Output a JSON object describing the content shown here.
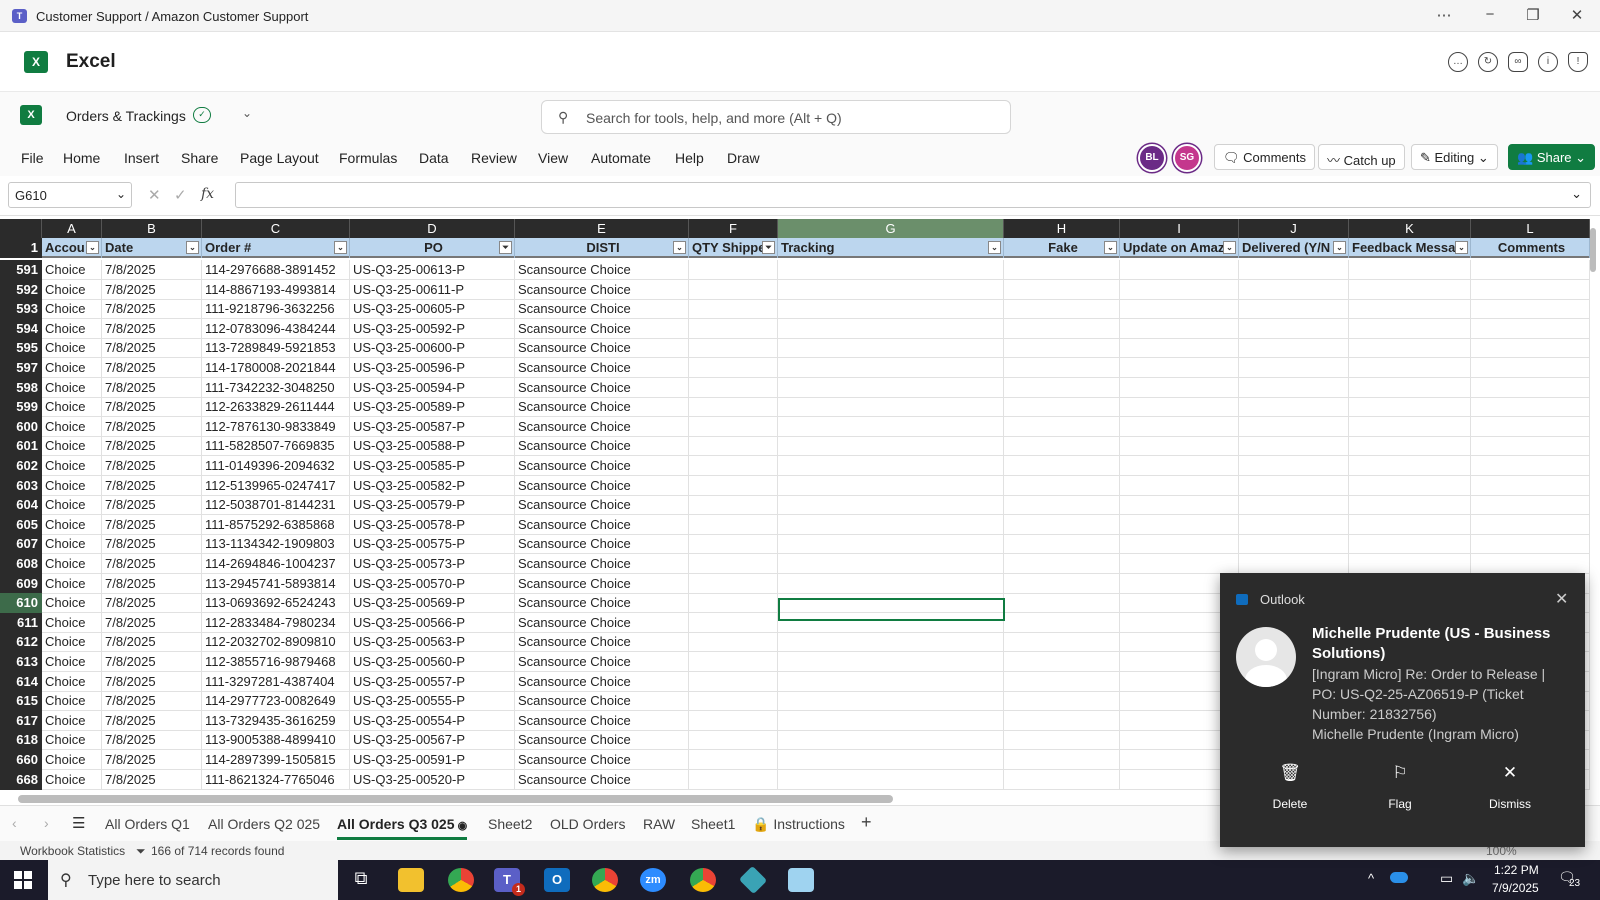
{
  "window": {
    "title": "Customer Support / Amazon Customer Support"
  },
  "app": {
    "name": "Excel",
    "file_name": "Orders & Trackings"
  },
  "search": {
    "placeholder": "Search for tools, help, and more (Alt + Q)"
  },
  "ribbon": {
    "tabs": [
      "File",
      "Home",
      "Insert",
      "Share",
      "Page Layout",
      "Formulas",
      "Data",
      "Review",
      "View",
      "Automate",
      "Help",
      "Draw"
    ],
    "avatars": [
      "BL",
      "SG"
    ],
    "comments_label": "Comments",
    "catchup_label": "Catch up",
    "editing_label": "Editing",
    "share_label": "Share"
  },
  "formula_bar": {
    "name_box": "G610",
    "formula": ""
  },
  "grid": {
    "column_letters": [
      "A",
      "B",
      "C",
      "D",
      "E",
      "F",
      "G",
      "H",
      "I",
      "J",
      "K",
      "L"
    ],
    "header_row_number": "1",
    "headers": [
      "Accou",
      "Date",
      "Order #",
      "PO",
      "DISTI",
      "QTY Shippe",
      "Tracking",
      "Fake",
      "Update on Amaz",
      "Delivered (Y/N",
      "Feedback Messa",
      "Comments"
    ],
    "filtered_columns": [
      "D",
      "F"
    ],
    "selected_column": "G",
    "selected_cell": "G610",
    "rows": [
      {
        "n": "591",
        "a": "Choice",
        "b": "7/8/2025",
        "c": "114-2976688-3891452",
        "d": "US-Q3-25-00613-P",
        "e": "Scansource Choice"
      },
      {
        "n": "592",
        "a": "Choice",
        "b": "7/8/2025",
        "c": "114-8867193-4993814",
        "d": "US-Q3-25-00611-P",
        "e": "Scansource Choice"
      },
      {
        "n": "593",
        "a": "Choice",
        "b": "7/8/2025",
        "c": "111-9218796-3632256",
        "d": "US-Q3-25-00605-P",
        "e": "Scansource Choice"
      },
      {
        "n": "594",
        "a": "Choice",
        "b": "7/8/2025",
        "c": "112-0783096-4384244",
        "d": "US-Q3-25-00592-P",
        "e": "Scansource Choice"
      },
      {
        "n": "595",
        "a": "Choice",
        "b": "7/8/2025",
        "c": "113-7289849-5921853",
        "d": "US-Q3-25-00600-P",
        "e": "Scansource Choice"
      },
      {
        "n": "597",
        "a": "Choice",
        "b": "7/8/2025",
        "c": "114-1780008-2021844",
        "d": "US-Q3-25-00596-P",
        "e": "Scansource Choice"
      },
      {
        "n": "598",
        "a": "Choice",
        "b": "7/8/2025",
        "c": "111-7342232-3048250",
        "d": "US-Q3-25-00594-P",
        "e": "Scansource Choice"
      },
      {
        "n": "599",
        "a": "Choice",
        "b": "7/8/2025",
        "c": "112-2633829-2611444",
        "d": "US-Q3-25-00589-P",
        "e": "Scansource Choice"
      },
      {
        "n": "600",
        "a": "Choice",
        "b": "7/8/2025",
        "c": "112-7876130-9833849",
        "d": "US-Q3-25-00587-P",
        "e": "Scansource Choice"
      },
      {
        "n": "601",
        "a": "Choice",
        "b": "7/8/2025",
        "c": "111-5828507-7669835",
        "d": "US-Q3-25-00588-P",
        "e": "Scansource Choice"
      },
      {
        "n": "602",
        "a": "Choice",
        "b": "7/8/2025",
        "c": "111-0149396-2094632",
        "d": "US-Q3-25-00585-P",
        "e": "Scansource Choice"
      },
      {
        "n": "603",
        "a": "Choice",
        "b": "7/8/2025",
        "c": "112-5139965-0247417",
        "d": "US-Q3-25-00582-P",
        "e": "Scansource Choice"
      },
      {
        "n": "604",
        "a": "Choice",
        "b": "7/8/2025",
        "c": "112-5038701-8144231",
        "d": "US-Q3-25-00579-P",
        "e": "Scansource Choice"
      },
      {
        "n": "605",
        "a": "Choice",
        "b": "7/8/2025",
        "c": "111-8575292-6385868",
        "d": "US-Q3-25-00578-P",
        "e": "Scansource Choice"
      },
      {
        "n": "607",
        "a": "Choice",
        "b": "7/8/2025",
        "c": "113-1134342-1909803",
        "d": "US-Q3-25-00575-P",
        "e": "Scansource Choice"
      },
      {
        "n": "608",
        "a": "Choice",
        "b": "7/8/2025",
        "c": "114-2694846-1004237",
        "d": "US-Q3-25-00573-P",
        "e": "Scansource Choice"
      },
      {
        "n": "609",
        "a": "Choice",
        "b": "7/8/2025",
        "c": "113-2945741-5893814",
        "d": "US-Q3-25-00570-P",
        "e": "Scansource Choice"
      },
      {
        "n": "610",
        "a": "Choice",
        "b": "7/8/2025",
        "c": "113-0693692-6524243",
        "d": "US-Q3-25-00569-P",
        "e": "Scansource Choice"
      },
      {
        "n": "611",
        "a": "Choice",
        "b": "7/8/2025",
        "c": "112-2833484-7980234",
        "d": "US-Q3-25-00566-P",
        "e": "Scansource Choice"
      },
      {
        "n": "612",
        "a": "Choice",
        "b": "7/8/2025",
        "c": "112-2032702-8909810",
        "d": "US-Q3-25-00563-P",
        "e": "Scansource Choice"
      },
      {
        "n": "613",
        "a": "Choice",
        "b": "7/8/2025",
        "c": "112-3855716-9879468",
        "d": "US-Q3-25-00560-P",
        "e": "Scansource Choice"
      },
      {
        "n": "614",
        "a": "Choice",
        "b": "7/8/2025",
        "c": "111-3297281-4387404",
        "d": "US-Q3-25-00557-P",
        "e": "Scansource Choice"
      },
      {
        "n": "615",
        "a": "Choice",
        "b": "7/8/2025",
        "c": "114-2977723-0082649",
        "d": "US-Q3-25-00555-P",
        "e": "Scansource Choice"
      },
      {
        "n": "617",
        "a": "Choice",
        "b": "7/8/2025",
        "c": "113-7329435-3616259",
        "d": "US-Q3-25-00554-P",
        "e": "Scansource Choice"
      },
      {
        "n": "618",
        "a": "Choice",
        "b": "7/8/2025",
        "c": "113-9005388-4899410",
        "d": "US-Q3-25-00567-P",
        "e": "Scansource Choice"
      },
      {
        "n": "660",
        "a": "Choice",
        "b": "7/8/2025",
        "c": "114-2897399-1505815",
        "d": "US-Q3-25-00591-P",
        "e": "Scansource Choice"
      },
      {
        "n": "668",
        "a": "Choice",
        "b": "7/8/2025",
        "c": "111-8621324-7765046",
        "d": "US-Q3-25-00520-P",
        "e": "Scansource Choice"
      }
    ]
  },
  "sheets": {
    "tabs": [
      "All Orders Q1",
      "All Orders Q2 025",
      "All Orders Q3 025",
      "Sheet2",
      "OLD Orders",
      "RAW",
      "Sheet1",
      "Instructions"
    ],
    "active": "All Orders Q3 025",
    "add_label": "+"
  },
  "status": {
    "stats_label": "Workbook Statistics",
    "records": "166 of 714 records found",
    "zoom": "100%"
  },
  "taskbar": {
    "search_placeholder": "Type here to search",
    "time": "1:22 PM",
    "date": "7/9/2025",
    "notification_count": "23",
    "teams_badge": "1"
  },
  "toast": {
    "app": "Outlook",
    "sender": "Michelle Prudente (US - Business Solutions)",
    "body": "[Ingram Micro] Re: Order to Release | PO: US-Q2-25-AZ06519-P (Ticket Number: 21832756)",
    "from_line": "Michelle Prudente (Ingram Micro)",
    "actions": [
      "Delete",
      "Flag",
      "Dismiss"
    ]
  },
  "colors": {
    "excel_green": "#107c41",
    "header_fill": "#bcd6ee",
    "avatar_border": "#6b2a86",
    "toast_bg": "#2b2b2b"
  }
}
